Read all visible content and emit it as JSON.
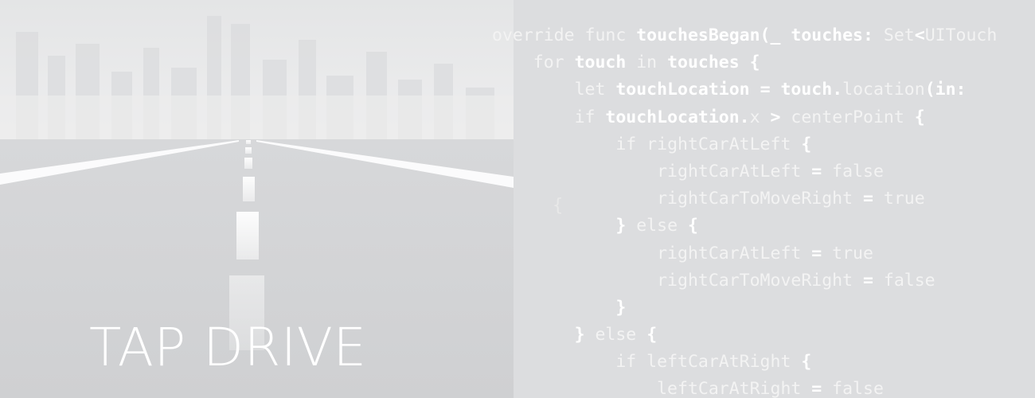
{
  "app": {
    "title": "TAP DRIVE"
  },
  "colors": {
    "background": "#dcdddf",
    "sky_top": "#e6e6e7",
    "road": "#d3d4d6",
    "lane_marking": "#ffffff",
    "code_text": "#f3f3f3",
    "code_emphasis": "#ffffff"
  },
  "code": {
    "lines": [
      {
        "indent": "",
        "tokens": [
          {
            "t": "override func ",
            "c": "kw"
          },
          {
            "t": "touchesBegan(",
            "c": "fn"
          },
          {
            "t": "_ ",
            "c": "punct"
          },
          {
            "t": "touches:",
            "c": "id"
          },
          {
            "t": " Set",
            "c": "kw"
          },
          {
            "t": "<",
            "c": "punct"
          },
          {
            "t": "UITouch",
            "c": "kw"
          }
        ]
      },
      {
        "indent": "    ",
        "tokens": [
          {
            "t": "for ",
            "c": "kw"
          },
          {
            "t": "touch",
            "c": "id"
          },
          {
            "t": " in ",
            "c": "kw"
          },
          {
            "t": "touches",
            "c": "id"
          },
          {
            "t": " {",
            "c": "punct"
          }
        ]
      },
      {
        "indent": "        ",
        "tokens": [
          {
            "t": "let ",
            "c": "kw"
          },
          {
            "t": "touchLocation",
            "c": "id"
          },
          {
            "t": " = ",
            "c": "punct"
          },
          {
            "t": "touch.",
            "c": "id"
          },
          {
            "t": "location",
            "c": "kw"
          },
          {
            "t": "(in:",
            "c": "punct"
          }
        ]
      },
      {
        "indent": "        ",
        "tokens": [
          {
            "t": "if ",
            "c": "kw"
          },
          {
            "t": "touchLocation.",
            "c": "id"
          },
          {
            "t": "x",
            "c": "kw"
          },
          {
            "t": " > ",
            "c": "punct"
          },
          {
            "t": "centerPoint",
            "c": "kw"
          },
          {
            "t": " {",
            "c": "punct"
          }
        ]
      },
      {
        "indent": "            ",
        "tokens": [
          {
            "t": "if rightCarAtLeft",
            "c": "kw"
          },
          {
            "t": " {",
            "c": "punct"
          }
        ]
      },
      {
        "indent": "                ",
        "tokens": [
          {
            "t": "rightCarAtLeft",
            "c": "kw"
          },
          {
            "t": " = ",
            "c": "punct"
          },
          {
            "t": "false",
            "c": "lit"
          }
        ]
      },
      {
        "indent": "                ",
        "tokens": [
          {
            "t": "rightCarToMoveRight",
            "c": "kw"
          },
          {
            "t": " = ",
            "c": "punct"
          },
          {
            "t": "true",
            "c": "lit"
          }
        ]
      },
      {
        "indent": "            ",
        "tokens": [
          {
            "t": "}",
            "c": "punct"
          },
          {
            "t": " else ",
            "c": "kw"
          },
          {
            "t": "{",
            "c": "punct"
          }
        ]
      },
      {
        "indent": "                ",
        "tokens": [
          {
            "t": "rightCarAtLeft",
            "c": "kw"
          },
          {
            "t": " = ",
            "c": "punct"
          },
          {
            "t": "true",
            "c": "lit"
          }
        ]
      },
      {
        "indent": "                ",
        "tokens": [
          {
            "t": "rightCarToMoveRight",
            "c": "kw"
          },
          {
            "t": " = ",
            "c": "punct"
          },
          {
            "t": "false",
            "c": "lit"
          }
        ]
      },
      {
        "indent": "            ",
        "tokens": [
          {
            "t": "}",
            "c": "punct"
          }
        ]
      },
      {
        "indent": "        ",
        "tokens": [
          {
            "t": "}",
            "c": "punct"
          },
          {
            "t": " else ",
            "c": "kw"
          },
          {
            "t": "{",
            "c": "punct"
          }
        ]
      },
      {
        "indent": "            ",
        "tokens": [
          {
            "t": "if leftCarAtRight",
            "c": "kw"
          },
          {
            "t": " {",
            "c": "punct"
          }
        ]
      },
      {
        "indent": "                ",
        "tokens": [
          {
            "t": "leftCarAtRight",
            "c": "kw"
          },
          {
            "t": " = ",
            "c": "punct"
          },
          {
            "t": "false",
            "c": "lit"
          }
        ]
      }
    ]
  }
}
